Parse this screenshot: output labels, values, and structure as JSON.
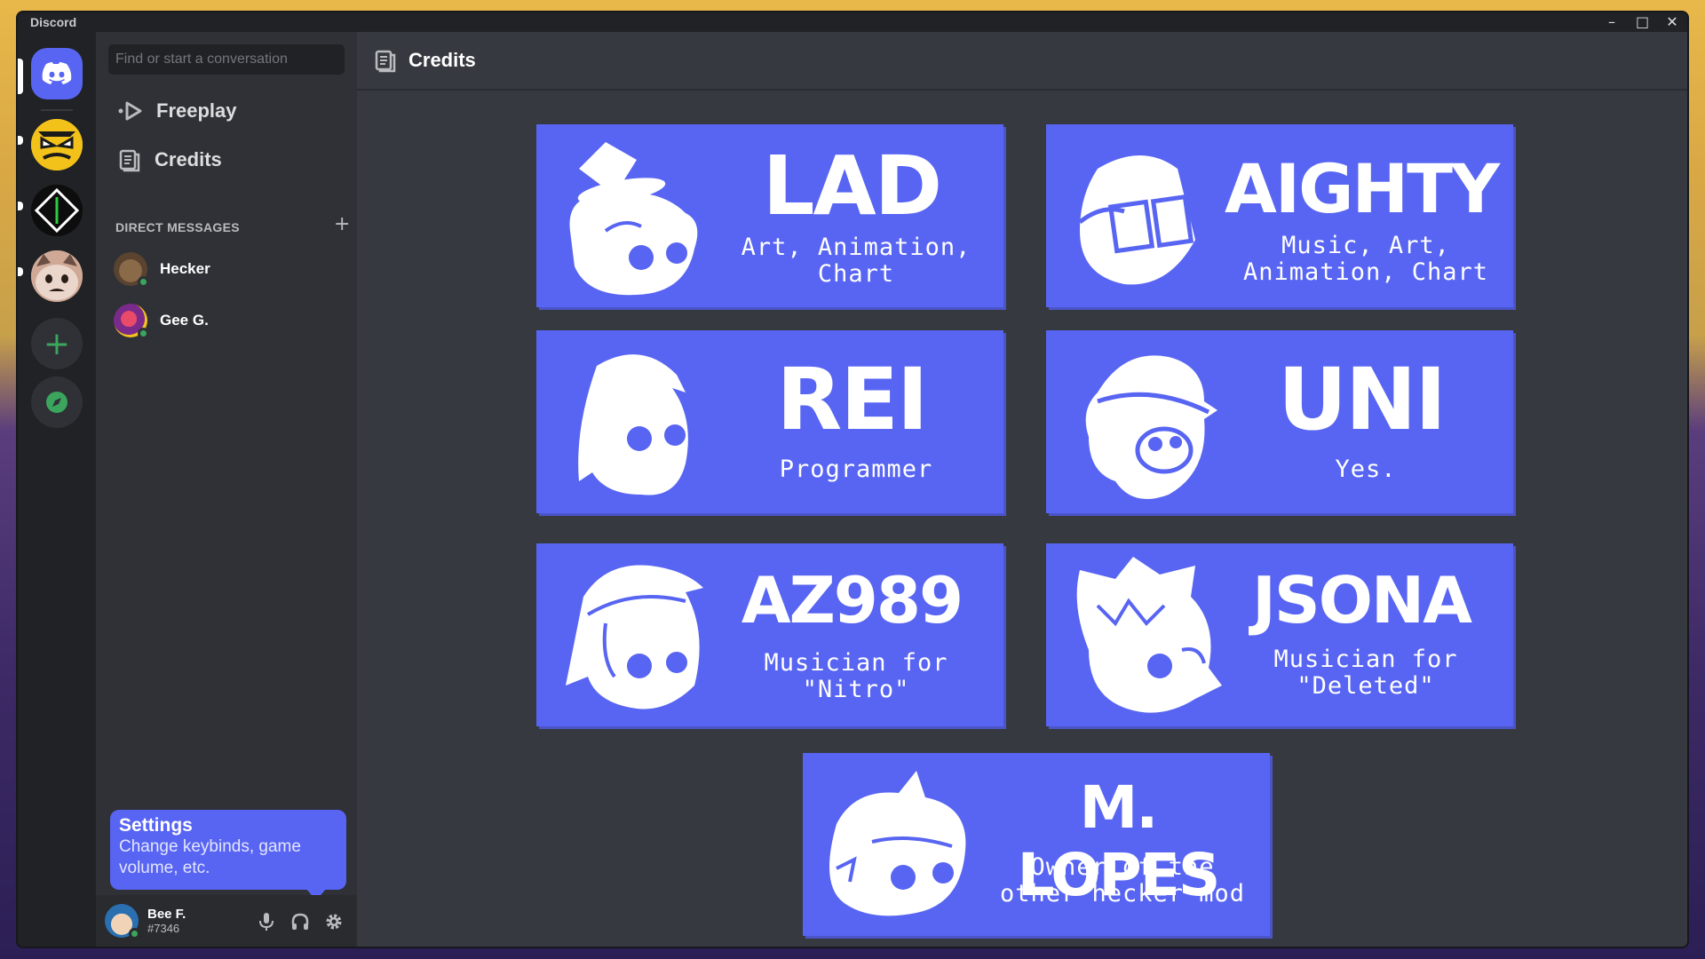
{
  "window": {
    "app_name": "Discord",
    "controls": [
      "–",
      "□",
      "✕"
    ]
  },
  "search": {
    "placeholder": "Find or start a conversation"
  },
  "nav": {
    "freeplay": "Freeplay",
    "credits": "Credits"
  },
  "direct_messages": {
    "header": "DIRECT MESSAGES",
    "add": "+",
    "items": [
      {
        "name": "Hecker"
      },
      {
        "name": "Gee G."
      }
    ]
  },
  "tooltip": {
    "title": "Settings",
    "body": "Change keybinds, game volume, etc."
  },
  "user": {
    "name": "Bee F.",
    "tag": "#7346"
  },
  "page": {
    "title": "Credits"
  },
  "credits": [
    {
      "name": "LAD",
      "role": "Art, Animation, Chart"
    },
    {
      "name": "AIGHTY",
      "role": "Music, Art, Animation, Chart"
    },
    {
      "name": "REI",
      "role": "Programmer"
    },
    {
      "name": "UNI",
      "role": "Yes."
    },
    {
      "name": "AZ989",
      "role": "Musician for \"Nitro\""
    },
    {
      "name": "JSONA",
      "role": "Musician for \"Deleted\""
    },
    {
      "name": "M. LOPES",
      "role": "Owner of the other hecker mod"
    }
  ],
  "colors": {
    "blurple": "#5865f2",
    "online": "#3ba55d",
    "background": "#36393f"
  },
  "icons": {
    "home": "discord-logo-icon",
    "add_server": "plus-icon",
    "explore": "compass-icon",
    "freeplay": "play-icon",
    "credits": "document-icon",
    "mic": "microphone-icon",
    "headphones": "headphones-icon",
    "settings": "gear-icon"
  }
}
